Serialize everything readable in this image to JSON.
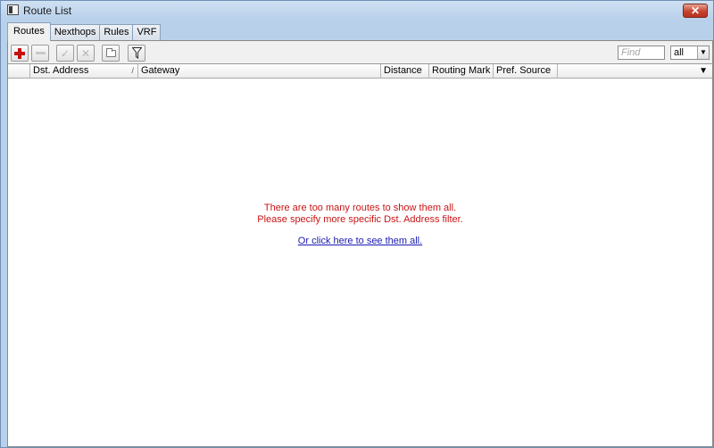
{
  "window": {
    "title": "Route List",
    "close_label": "✕"
  },
  "tabs": [
    {
      "label": "Routes",
      "active": true
    },
    {
      "label": "Nexthops",
      "active": false
    },
    {
      "label": "Rules",
      "active": false
    },
    {
      "label": "VRF",
      "active": false
    }
  ],
  "toolbar": {
    "buttons": [
      {
        "icon": "plus-icon",
        "enabled": true
      },
      {
        "icon": "minus-icon",
        "enabled": false
      },
      {
        "icon": "check-icon",
        "enabled": false
      },
      {
        "icon": "x-icon",
        "enabled": false
      },
      {
        "icon": "comment-icon",
        "enabled": true
      },
      {
        "icon": "filter-icon",
        "enabled": true
      }
    ],
    "find_placeholder": "Find",
    "find_value": "",
    "scope_value": "all"
  },
  "table": {
    "columns": [
      "",
      "Dst. Address",
      "Gateway",
      "Distance",
      "Routing Mark",
      "Pref. Source"
    ],
    "sort_column": "Dst. Address",
    "sort_mark": "/",
    "rows": []
  },
  "message": {
    "line1": "There are too many routes to show them all.",
    "line2": "Please specify more specific Dst. Address filter.",
    "link": "Or click here to see them all."
  },
  "colors": {
    "message_text": "#c81414",
    "link_text": "#1a1ab0",
    "add_icon": "#c41010",
    "window_frame": "#b9d0ea"
  }
}
